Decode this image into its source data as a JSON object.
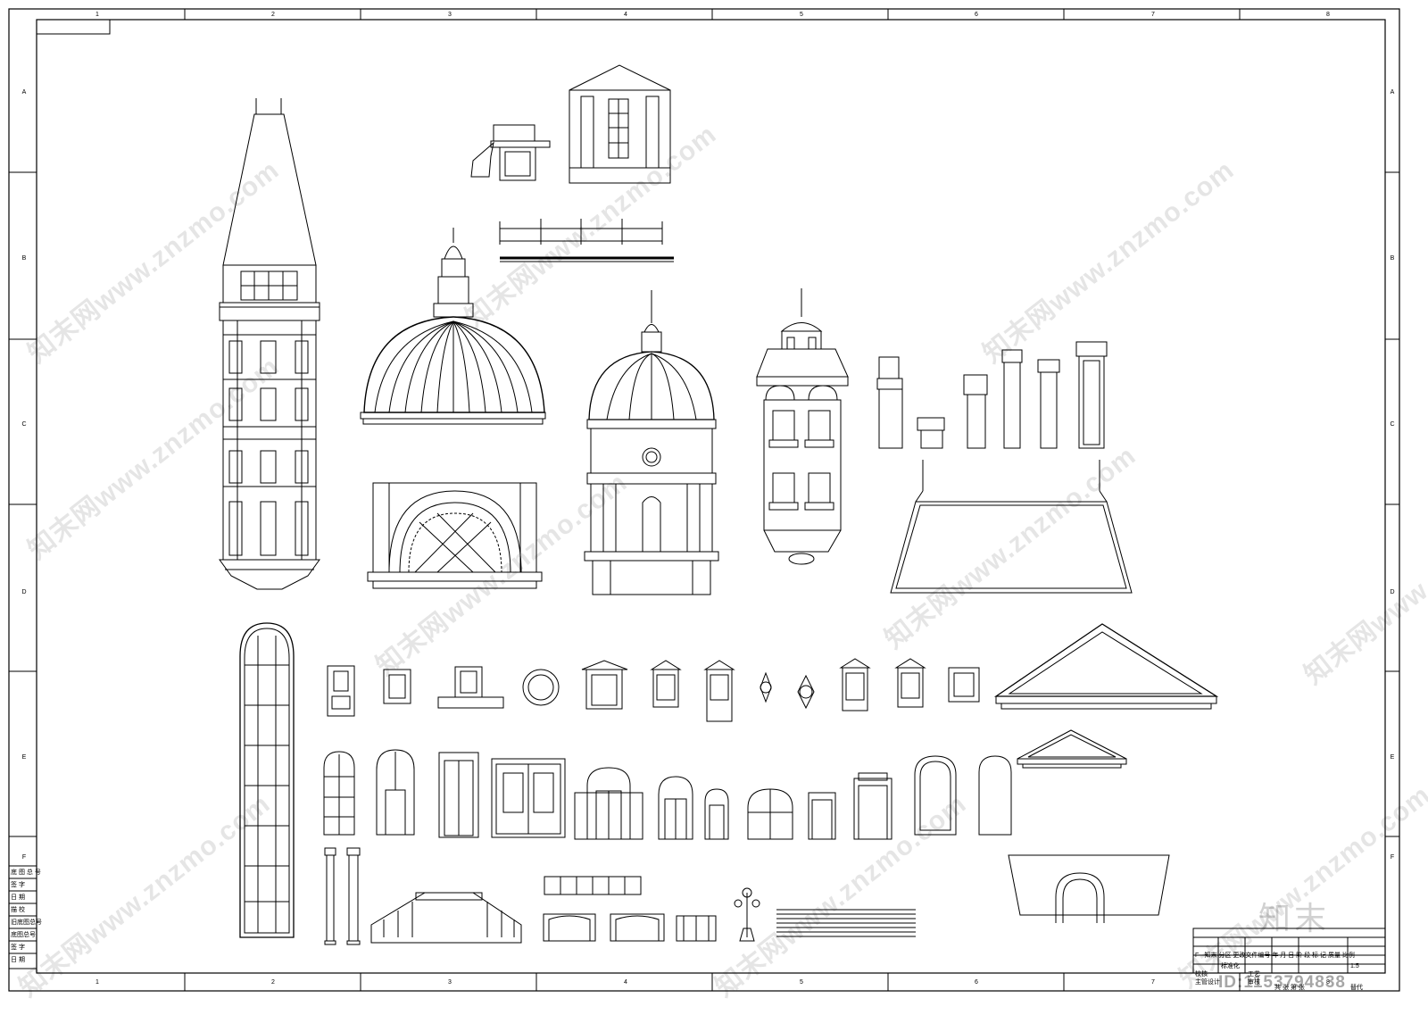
{
  "columns": [
    "1",
    "2",
    "3",
    "4",
    "5",
    "6",
    "7",
    "8"
  ],
  "rows": [
    "A",
    "B",
    "C",
    "D",
    "E",
    "F"
  ],
  "watermarks": [
    "知末网www.znzmo.com",
    "知末网www.znzmo.com",
    "知末网www.znzmo.com",
    "知末网www.znzmo.com",
    "知末网www.znzmo.com",
    "知末网www.znzmo.com",
    "知末网www.znzmo.com",
    "知末网www.znzmo.com",
    "知末网www.znzmo.com",
    "知末网www.znzmo.com"
  ],
  "stamp": {
    "rows": [
      "底 图 总 号",
      "签 字",
      "日 期",
      "描 校",
      "旧底图总号",
      "底图总号",
      "签 字",
      "日 期"
    ]
  },
  "title_block": {
    "line1": "F · 知末 分区 更改文件编号 年 月 日 阶 段 标 记 质量 比例",
    "scale": "1:5",
    "design": "设计",
    "standard": "标准化",
    "check": "校核",
    "craft": "工艺",
    "chief": "主管设计",
    "review": "审核",
    "approve": "批准",
    "sheets": "共 张 第 张",
    "replace": "替代"
  },
  "brand": "知末",
  "id_label": "ID:1153794838"
}
